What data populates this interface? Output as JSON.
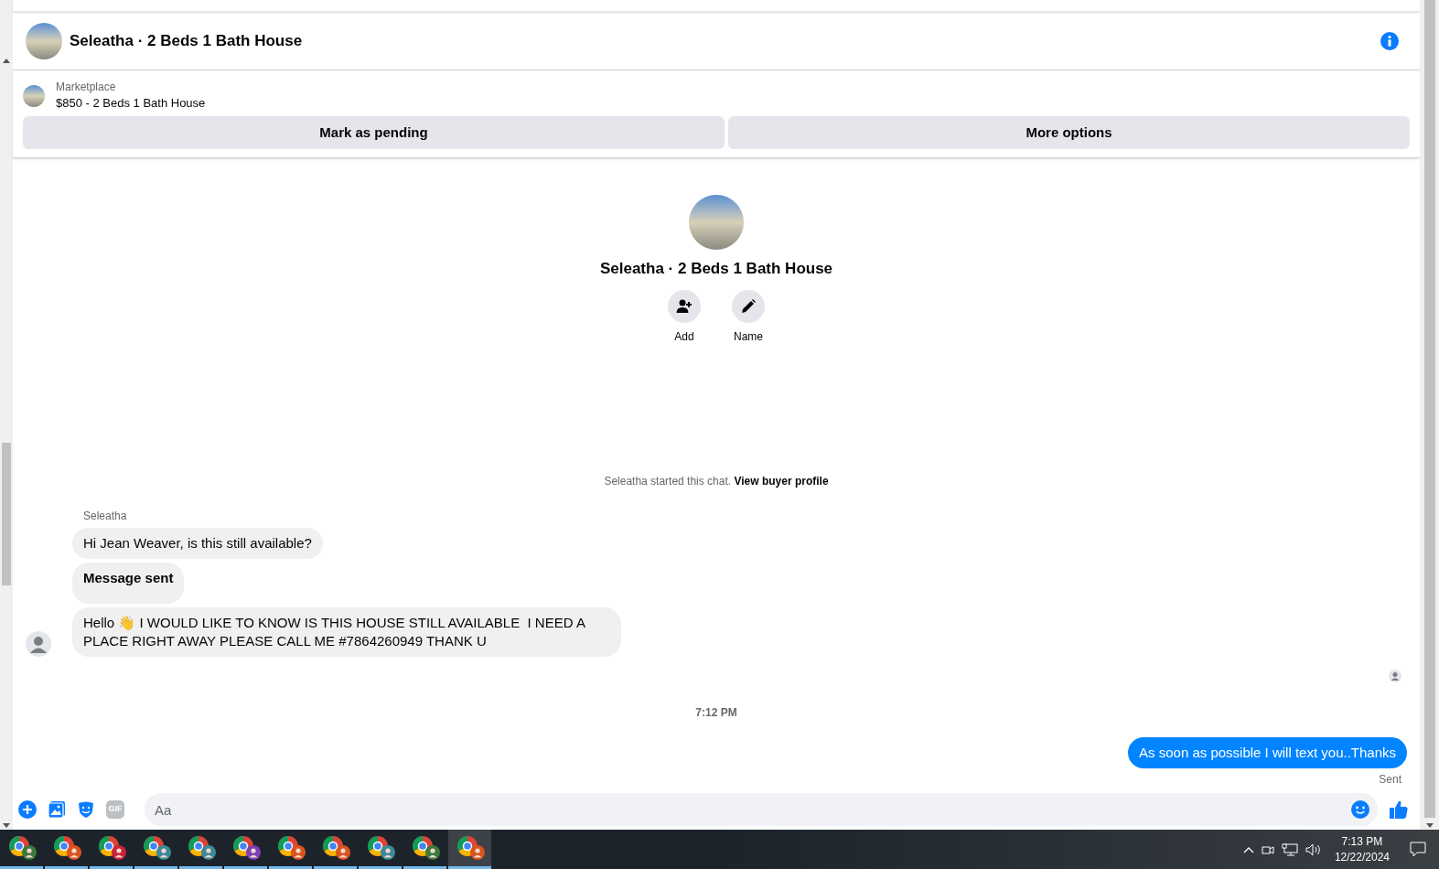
{
  "header": {
    "title": "Seleatha · 2 Beds 1 Bath House"
  },
  "listing": {
    "source": "Marketplace",
    "title": "$850 - 2 Beds 1 Bath House",
    "buttons": [
      "Mark as pending",
      "More options"
    ]
  },
  "profile": {
    "title": "Seleatha · 2 Beds 1 Bath House",
    "actions": [
      {
        "kind": "add",
        "label": "Add"
      },
      {
        "kind": "name",
        "label": "Name"
      }
    ]
  },
  "chat_notice": {
    "text": "Seleatha started this chat.",
    "link": "View buyer profile"
  },
  "messages": [
    {
      "kind": "sender",
      "text": "Seleatha"
    },
    {
      "kind": "incoming",
      "text": "Hi Jean Weaver, is this still available?"
    },
    {
      "kind": "incoming_bold",
      "text": "Message sent"
    },
    {
      "kind": "incoming",
      "text": "Hello 👋 I WOULD LIKE TO KNOW IS THIS HOUSE STILL AVAILABLE  I NEED A PLACE RIGHT AWAY PLEASE CALL ME #7864260949 THANK U"
    },
    {
      "kind": "seen"
    },
    {
      "kind": "time",
      "text": "7:12 PM"
    },
    {
      "kind": "outgoing",
      "text": "As soon as possible I will text you..Thanks"
    },
    {
      "kind": "status",
      "text": "Sent"
    }
  ],
  "composer": {
    "placeholder": "Aa",
    "gif_label": "GIF"
  },
  "taskbar": {
    "apps": [
      {
        "selected": false,
        "color": "#3c7a3c"
      },
      {
        "selected": false,
        "color": "#d9541e"
      },
      {
        "selected": false,
        "color": "#c8233a"
      },
      {
        "selected": false,
        "color": "#3a8a9a"
      },
      {
        "selected": false,
        "color": "#3a8a9a"
      },
      {
        "selected": false,
        "color": "#7b3fb8"
      },
      {
        "selected": false,
        "color": "#d9541e"
      },
      {
        "selected": false,
        "color": "#d9541e"
      },
      {
        "selected": false,
        "color": "#3a8a9a"
      },
      {
        "selected": false,
        "color": "#3c7a3c"
      },
      {
        "selected": true,
        "color": "#d9541e"
      }
    ],
    "time": "7:13 PM",
    "date": "12/22/2024"
  }
}
